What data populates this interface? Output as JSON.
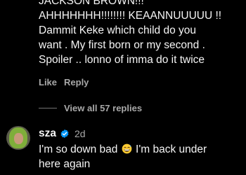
{
  "comment": {
    "lines": [
      "JACKSON BROWN!!!",
      "AHHHHHHH!!!!!!!! KEAANNUUUUU !!",
      "Dammit Keke which child do you",
      "want . My first born or my second .",
      "Spoiler .. lonno of imma do it twice"
    ],
    "like_label": "Like",
    "reply_label": "Reply"
  },
  "view_replies": {
    "label": "View all 57 replies"
  },
  "reply": {
    "username": "sza",
    "verified": "verified-badge-icon",
    "timestamp": "2d",
    "line1_before": "I'm so down bad",
    "emoji": "grinning-sweat-emoji",
    "line1_after": "I'm back under",
    "line2": "here again"
  },
  "colors": {
    "background": "#000000",
    "text_primary": "#f5f5f5",
    "text_secondary": "#a8a8a8",
    "verified_blue": "#0095f6"
  }
}
